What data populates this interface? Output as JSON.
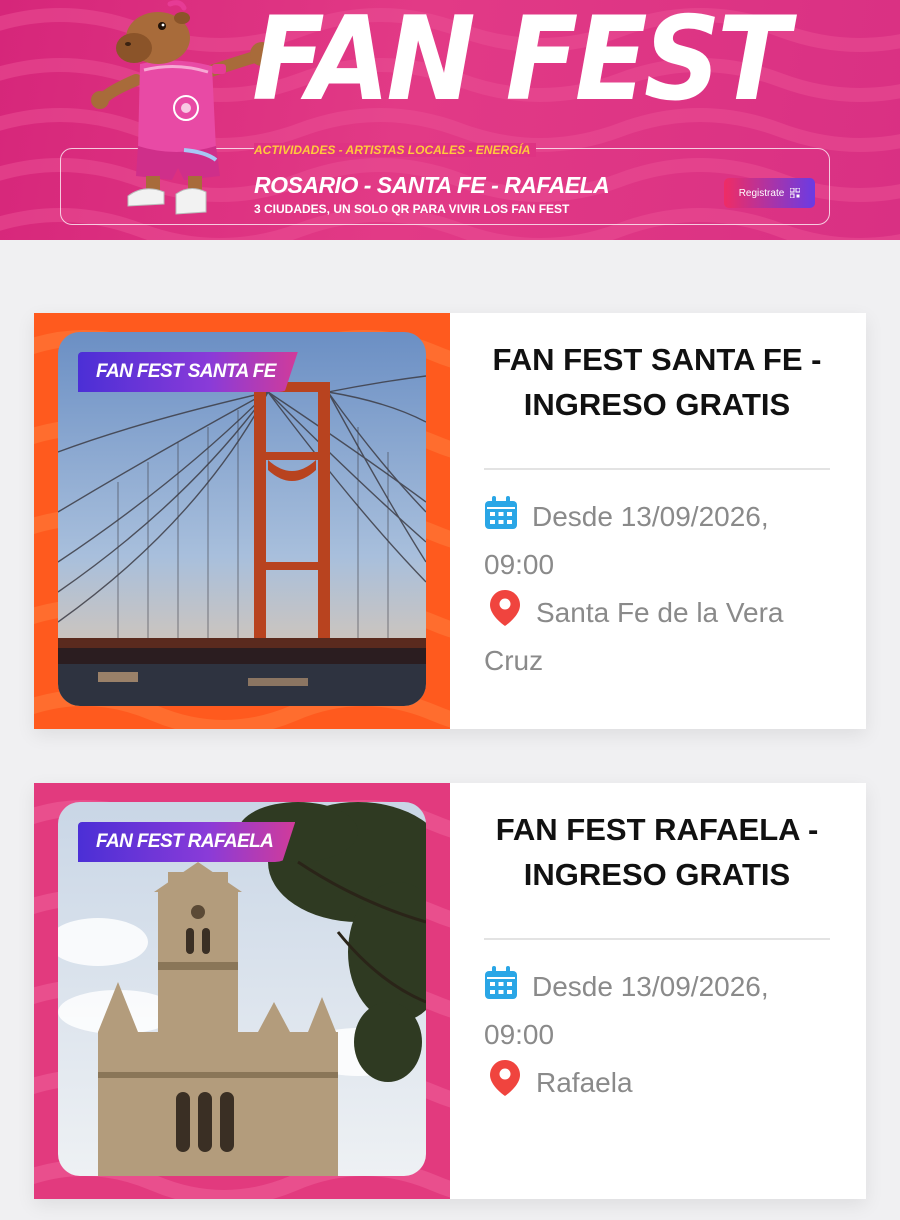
{
  "hero": {
    "title": "FAN FEST",
    "tagline": "ACTIVIDADES - ARTISTAS LOCALES - ENERGÍA",
    "cities": "ROSARIO - SANTA FE - RAFAELA",
    "subtitle": "3 CIUDADES, UN SOLO QR PARA VIVIR LOS FAN FEST",
    "register_label": "Registrate",
    "colors": {
      "background": "#d6267a",
      "tagline": "#ffc93c",
      "button_start": "#ef2c65",
      "button_end": "#6a3be4"
    }
  },
  "events": [
    {
      "badge": "FAN FEST SANTA FE",
      "title": "FAN FEST SANTA FE - INGRESO GRATIS",
      "date": "Desde 13/09/2026, 09:00",
      "location": "Santa Fe de la Vera Cruz",
      "frame_color": "#ff5a1e",
      "image": "suspension-bridge-photo"
    },
    {
      "badge": "FAN FEST RAFAELA",
      "title": "FAN FEST RAFAELA - INGRESO GRATIS",
      "date": "Desde 13/09/2026, 09:00",
      "location": "Rafaela",
      "frame_color": "#e23a7e",
      "image": "cathedral-photo"
    }
  ],
  "icons": {
    "date": "calendar-icon",
    "location": "map-pin-icon",
    "register": "qr-code-icon"
  },
  "colors": {
    "calendar": "#2aa6e6",
    "pin": "#f0443e",
    "page_bg": "#f0f0f2"
  }
}
